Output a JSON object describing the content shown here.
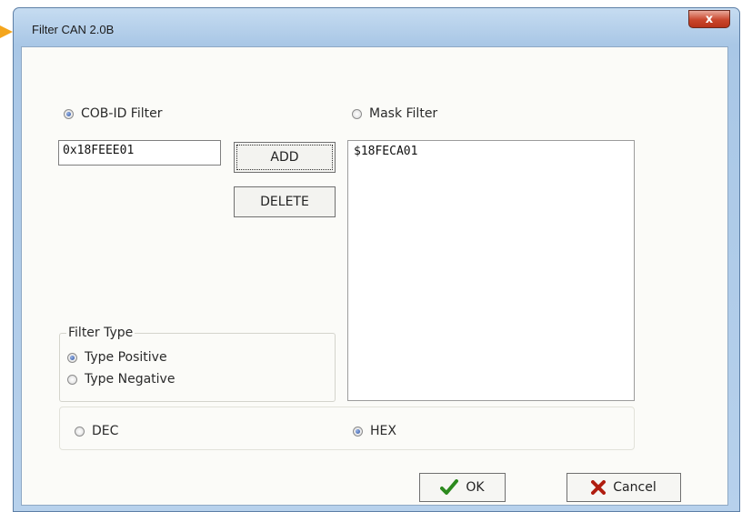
{
  "window": {
    "title": "Filter CAN 2.0B",
    "close_glyph": "x"
  },
  "filter_mode": {
    "options": [
      {
        "label": "COB-ID Filter",
        "checked": true
      },
      {
        "label": "Mask Filter",
        "checked": false
      }
    ]
  },
  "id_input": {
    "value": "0x18FEEE01"
  },
  "buttons": {
    "add": "ADD",
    "delete": "DELETE",
    "ok": "OK",
    "cancel": "Cancel"
  },
  "filter_list": {
    "items": [
      "$18FECA01"
    ]
  },
  "filter_type": {
    "label": "Filter Type",
    "options": [
      {
        "label": "Type Positive",
        "checked": true
      },
      {
        "label": "Type Negative",
        "checked": false
      }
    ]
  },
  "base": {
    "options": [
      {
        "label": "DEC",
        "checked": false
      },
      {
        "label": "HEX",
        "checked": true
      }
    ]
  },
  "icons": {
    "ok": "checkmark-icon",
    "cancel": "x-mark-icon",
    "pointer": "arrow-pointer-icon"
  },
  "colors": {
    "ok_icon": "#2c8a1e",
    "cancel_icon": "#b01d10",
    "pointer": "#f4a51c"
  }
}
